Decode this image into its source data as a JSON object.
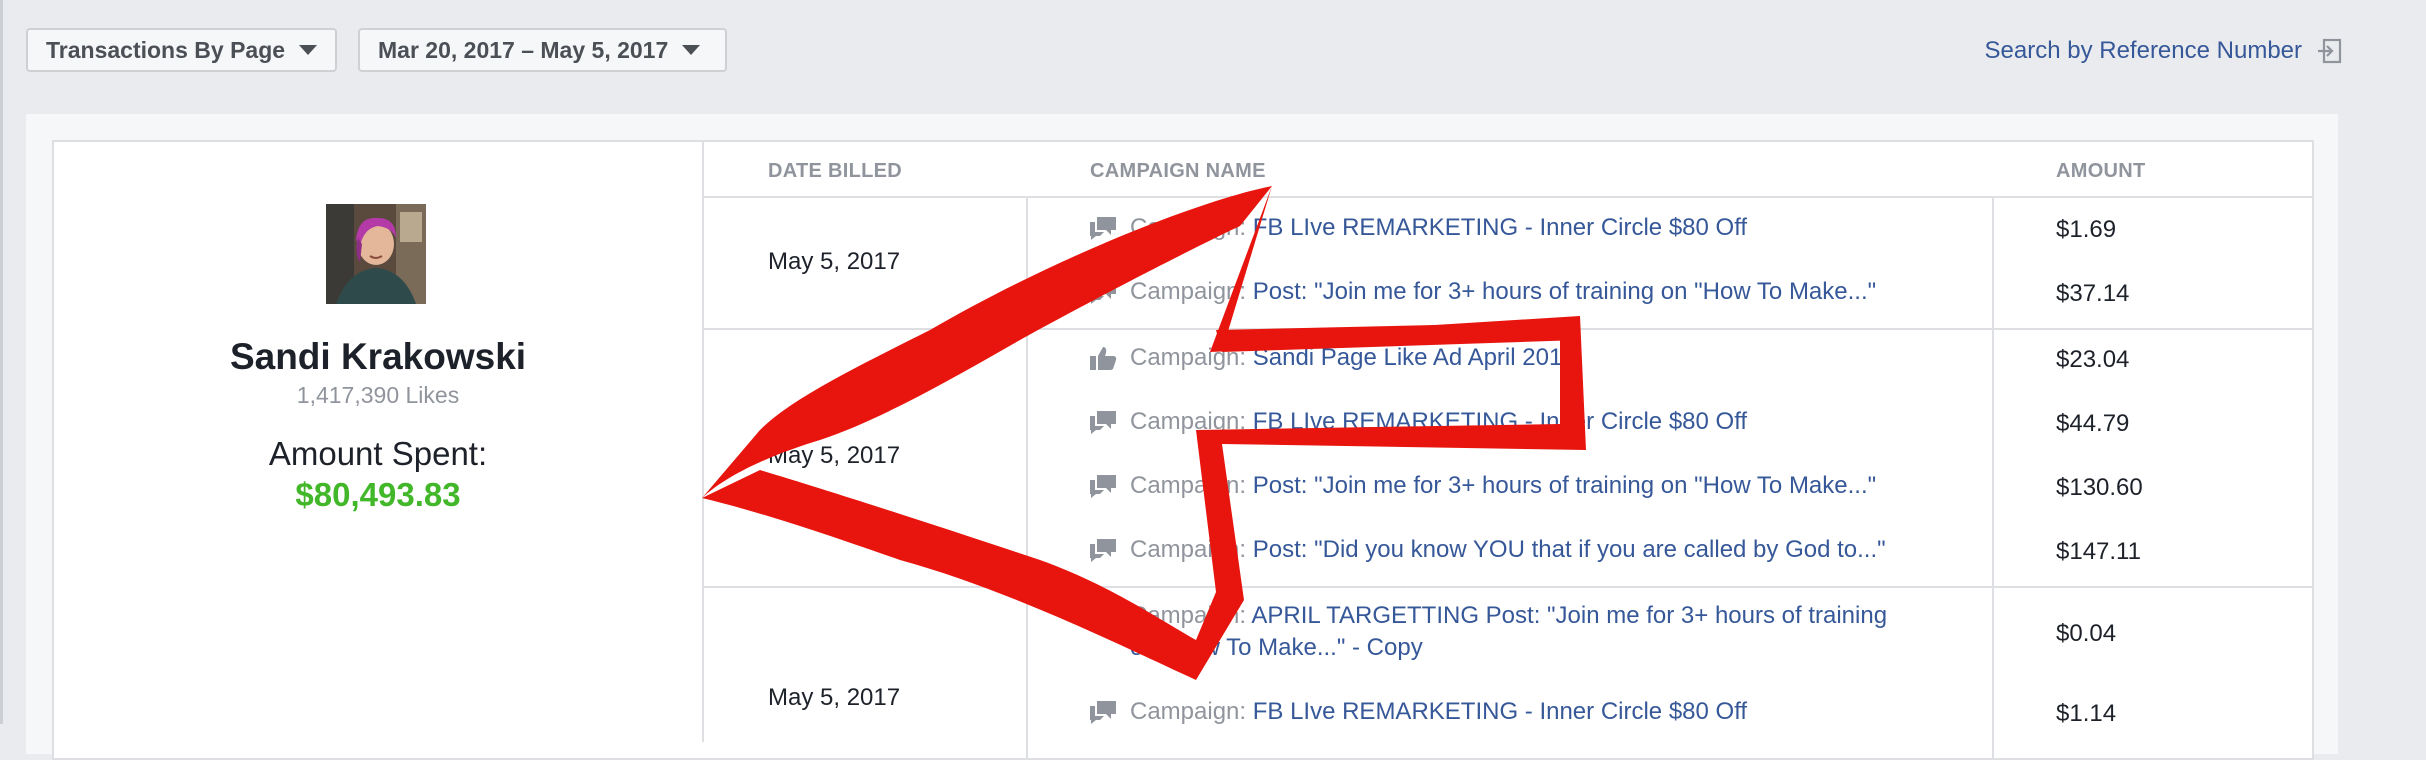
{
  "toolbar": {
    "view_label": "Transactions By Page",
    "range_label": "Mar 20, 2017 – May 5, 2017",
    "search_ref_label": "Search by Reference Number"
  },
  "profile": {
    "name": "Sandi Krakowski",
    "likes": "1,417,390 Likes",
    "spent_label": "Amount Spent:",
    "spent_value": "$80,493.83"
  },
  "table": {
    "headers": {
      "date": "DATE BILLED",
      "campaign": "CAMPAIGN NAME",
      "amount": "AMOUNT"
    },
    "groups": [
      {
        "date": "May 5, 2017"
      },
      {
        "date": "May 5, 2017"
      },
      {
        "date": "May 5, 2017"
      }
    ],
    "rows": [
      {
        "icon": "comment-icon",
        "prefix": "Campaign:",
        "name": "FB LIve REMARKETING - Inner Circle $80 Off",
        "amount": "$1.69"
      },
      {
        "icon": "comment-icon",
        "prefix": "Campaign:",
        "name": "Post: \"Join me for 3+ hours of training on \"How To Make...\"",
        "amount": "$37.14"
      },
      {
        "icon": "thumbs-up-icon",
        "prefix": "Campaign:",
        "name": "Sandi Page Like Ad April 2017",
        "amount": "$23.04"
      },
      {
        "icon": "comment-icon",
        "prefix": "Campaign:",
        "name": "FB LIve REMARKETING - Inner Circle $80 Off",
        "amount": "$44.79"
      },
      {
        "icon": "comment-icon",
        "prefix": "Campaign:",
        "name": "Post: \"Join me for 3+ hours of training on \"How To Make...\"",
        "amount": "$130.60"
      },
      {
        "icon": "comment-icon",
        "prefix": "Campaign:",
        "name": "Post: \"Did you know YOU that if you are called by God to...\"",
        "amount": "$147.11"
      },
      {
        "icon": "comment-icon",
        "prefix": "Campaign:",
        "name": "APRIL TARGETTING Post: \"Join me for 3+ hours of training on \"How To Make...\" - Copy",
        "amount": "$0.04"
      },
      {
        "icon": "comment-icon",
        "prefix": "Campaign:",
        "name": "FB LIve REMARKETING - Inner Circle $80 Off",
        "amount": "$1.14"
      }
    ]
  },
  "colors": {
    "link": "#365899",
    "spent": "#42b72a",
    "annotation_arrow": "#e8150e"
  }
}
